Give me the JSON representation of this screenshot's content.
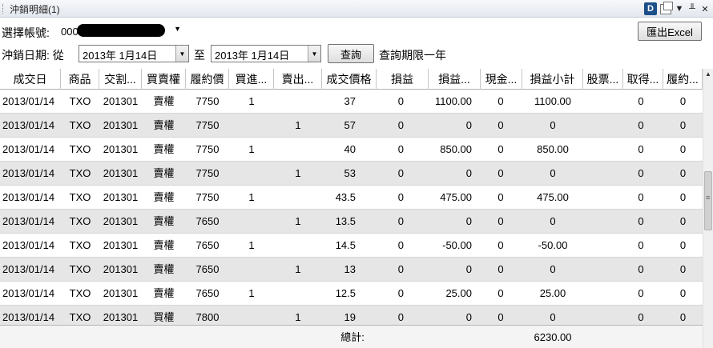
{
  "window": {
    "title": "沖銷明細(1)"
  },
  "titlebar_icons": [
    "d-badge-icon",
    "window-icon",
    "dropdown-icon",
    "pin-icon",
    "close-icon"
  ],
  "titlebar_glyphs": {
    "d": "D",
    "dropdown": "▼",
    "pin": "╨",
    "close": "✕"
  },
  "account": {
    "label": "選擇帳號:",
    "value_prefix": "000"
  },
  "export_button": {
    "label": "匯出Excel"
  },
  "date_range": {
    "label": "沖銷日期: 從",
    "from": "2013年  1月14日",
    "to_label": "至",
    "to": "2013年  1月14日"
  },
  "query_button": {
    "label": "查詢"
  },
  "query_note": "查詢期限一年",
  "table": {
    "columns": [
      "成交日",
      "商品",
      "交割...",
      "買賣權",
      "履約價",
      "買進...",
      "賣出...",
      "成交價格",
      "損益",
      "損益...",
      "現金...",
      "損益小計",
      "股票...",
      "取得...",
      "履約..."
    ],
    "rows": [
      [
        "2013/01/14",
        "TXO",
        "201301",
        "賣權",
        "7750",
        "1",
        "",
        "37",
        "0",
        "1100.00",
        "0",
        "1100.00",
        "",
        "0",
        "0"
      ],
      [
        "2013/01/14",
        "TXO",
        "201301",
        "賣權",
        "7750",
        "",
        "1",
        "57",
        "0",
        "0",
        "0",
        "0",
        "",
        "0",
        "0"
      ],
      [
        "2013/01/14",
        "TXO",
        "201301",
        "賣權",
        "7750",
        "1",
        "",
        "40",
        "0",
        "850.00",
        "0",
        "850.00",
        "",
        "0",
        "0"
      ],
      [
        "2013/01/14",
        "TXO",
        "201301",
        "賣權",
        "7750",
        "",
        "1",
        "53",
        "0",
        "0",
        "0",
        "0",
        "",
        "0",
        "0"
      ],
      [
        "2013/01/14",
        "TXO",
        "201301",
        "賣權",
        "7750",
        "1",
        "",
        "43.5",
        "0",
        "475.00",
        "0",
        "475.00",
        "",
        "0",
        "0"
      ],
      [
        "2013/01/14",
        "TXO",
        "201301",
        "賣權",
        "7650",
        "",
        "1",
        "13.5",
        "0",
        "0",
        "0",
        "0",
        "",
        "0",
        "0"
      ],
      [
        "2013/01/14",
        "TXO",
        "201301",
        "賣權",
        "7650",
        "1",
        "",
        "14.5",
        "0",
        "-50.00",
        "0",
        "-50.00",
        "",
        "0",
        "0"
      ],
      [
        "2013/01/14",
        "TXO",
        "201301",
        "賣權",
        "7650",
        "",
        "1",
        "13",
        "0",
        "0",
        "0",
        "0",
        "",
        "0",
        "0"
      ],
      [
        "2013/01/14",
        "TXO",
        "201301",
        "賣權",
        "7650",
        "1",
        "",
        "12.5",
        "0",
        "25.00",
        "0",
        "25.00",
        "",
        "0",
        "0"
      ],
      [
        "2013/01/14",
        "TXO",
        "201301",
        "買權",
        "7800",
        "",
        "1",
        "19",
        "0",
        "0",
        "0",
        "0",
        "",
        "0",
        "0"
      ]
    ],
    "total_label": "總計:",
    "total_value": "6230.00"
  }
}
